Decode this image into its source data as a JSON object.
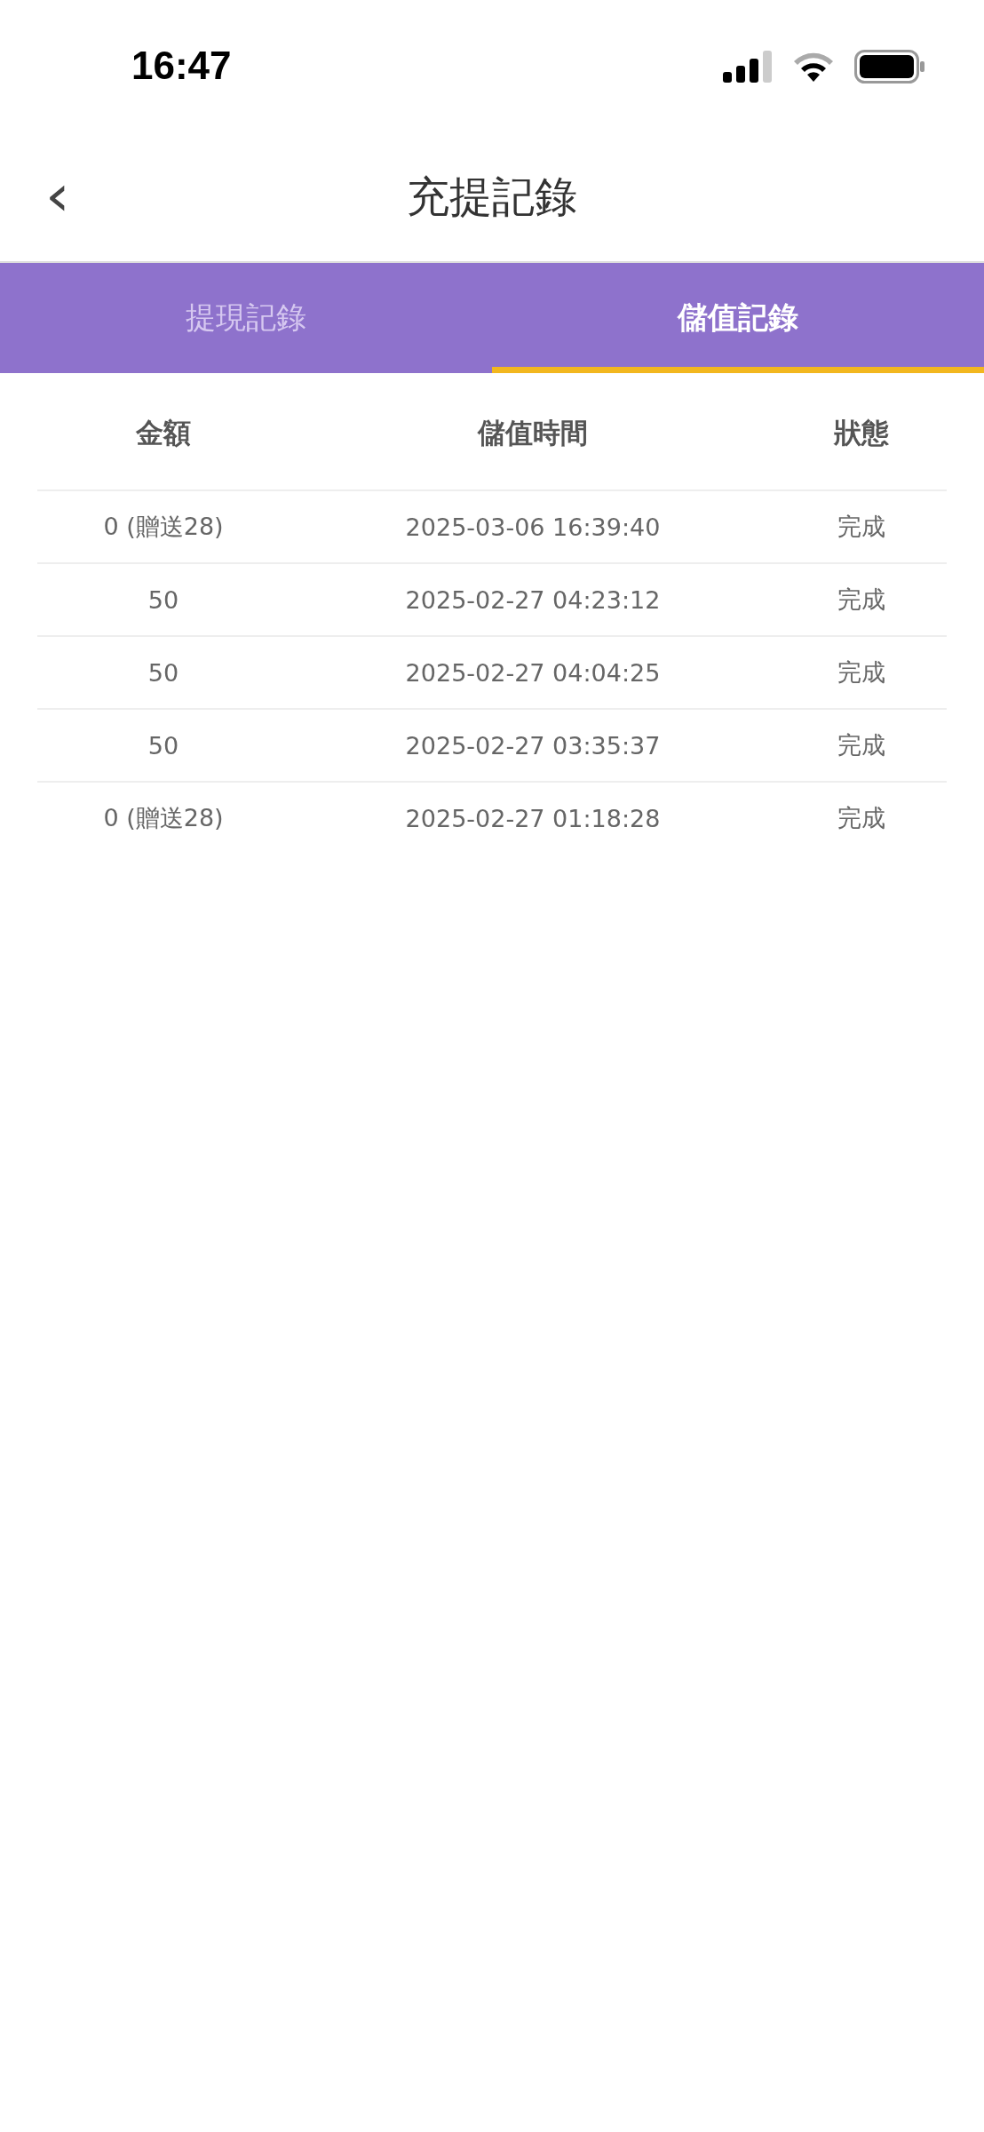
{
  "status_bar": {
    "time": "16:47"
  },
  "nav": {
    "back": "‹",
    "title": "充提記錄"
  },
  "tabs": [
    {
      "label": "提現記錄",
      "selected": false
    },
    {
      "label": "儲值記錄",
      "selected": true
    }
  ],
  "table": {
    "columns": [
      "金額",
      "儲值時間",
      "狀態"
    ],
    "rows": [
      [
        "0 (贈送28)",
        "2025-03-06 16:39:40",
        "完成"
      ],
      [
        "50",
        "2025-02-27 04:23:12",
        "完成"
      ],
      [
        "50",
        "2025-02-27 04:04:25",
        "完成"
      ],
      [
        "50",
        "2025-02-27 03:35:37",
        "完成"
      ],
      [
        "0 (贈送28)",
        "2025-02-27 01:18:28",
        "完成"
      ]
    ]
  }
}
